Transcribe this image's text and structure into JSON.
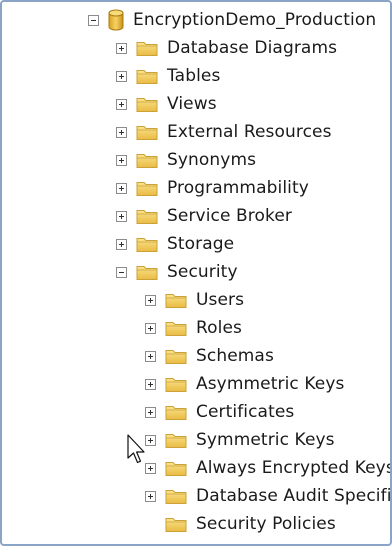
{
  "tree": {
    "root": {
      "label": "EncryptionDemo_Production",
      "icon": "database-icon",
      "expanded": true
    },
    "children": [
      {
        "label": "Database Diagrams",
        "icon": "folder-icon",
        "expanded": false
      },
      {
        "label": "Tables",
        "icon": "folder-icon",
        "expanded": false
      },
      {
        "label": "Views",
        "icon": "folder-icon",
        "expanded": false
      },
      {
        "label": "External Resources",
        "icon": "folder-icon",
        "expanded": false
      },
      {
        "label": "Synonyms",
        "icon": "folder-icon",
        "expanded": false
      },
      {
        "label": "Programmability",
        "icon": "folder-icon",
        "expanded": false
      },
      {
        "label": "Service Broker",
        "icon": "folder-icon",
        "expanded": false
      },
      {
        "label": "Storage",
        "icon": "folder-icon",
        "expanded": false
      },
      {
        "label": "Security",
        "icon": "folder-icon",
        "expanded": true,
        "children": [
          {
            "label": "Users",
            "icon": "folder-icon",
            "expanded": false
          },
          {
            "label": "Roles",
            "icon": "folder-icon",
            "expanded": false
          },
          {
            "label": "Schemas",
            "icon": "folder-icon",
            "expanded": false
          },
          {
            "label": "Asymmetric Keys",
            "icon": "folder-icon",
            "expanded": false
          },
          {
            "label": "Certificates",
            "icon": "folder-icon",
            "expanded": false
          },
          {
            "label": "Symmetric Keys",
            "icon": "folder-icon",
            "expanded": false
          },
          {
            "label": "Always Encrypted Keys",
            "icon": "folder-icon",
            "expanded": false
          },
          {
            "label": "Database Audit Specific",
            "icon": "folder-icon",
            "expanded": false
          },
          {
            "label": "Security Policies",
            "icon": "folder-icon",
            "expanded": null
          }
        ]
      }
    ]
  },
  "colors": {
    "frame_border": "#8aa4c8",
    "folder_fill": "#f3cf61",
    "folder_edge": "#c9a23a",
    "database_fill": "#e8b832",
    "text": "#1a1a1a"
  }
}
